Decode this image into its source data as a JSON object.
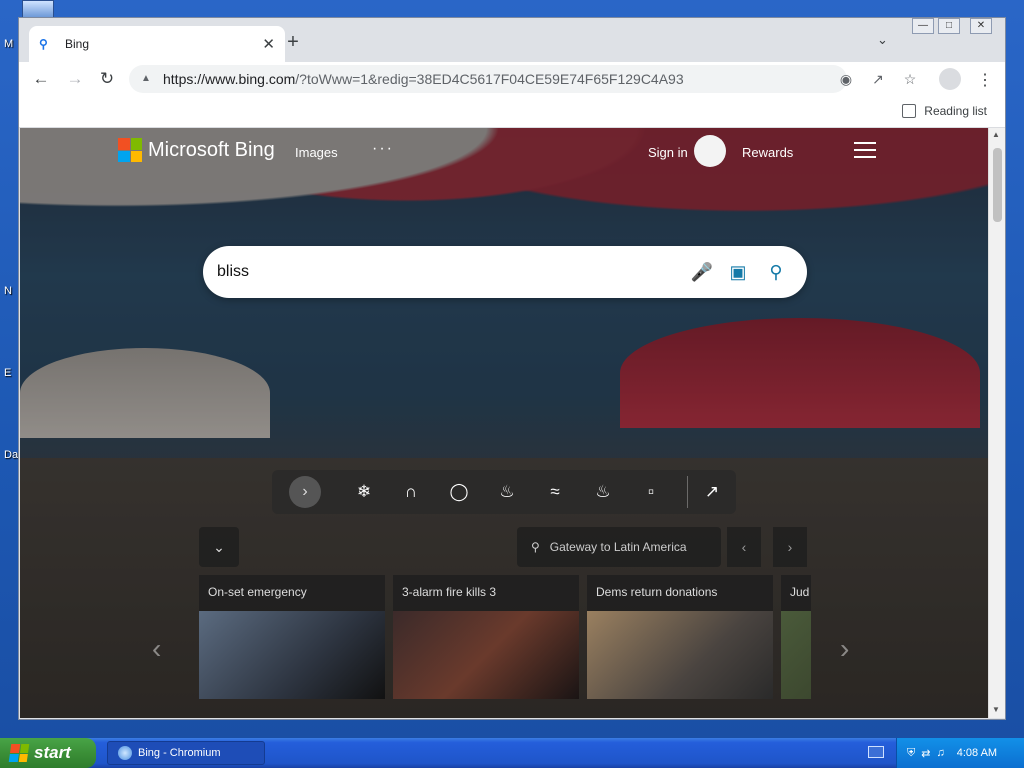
{
  "desktop": {
    "labels": [
      "M",
      "N",
      "E",
      "Da"
    ]
  },
  "window": {
    "title_controls": [
      "minimize",
      "maximize",
      "close"
    ]
  },
  "tab": {
    "title": "Bing",
    "favicon": "search-icon"
  },
  "toolbar": {
    "url_host": "https://www.bing.com",
    "url_rest": "/?toWww=1&redig=38ED4C5617F04CE59E74F65F129C4A93",
    "reading_list": "Reading list"
  },
  "bing": {
    "logo_text": "Microsoft Bing",
    "nav_images": "Images",
    "nav_more": "···",
    "sign_in": "Sign in",
    "rewards": "Rewards",
    "search_value": "bliss",
    "location": "Gateway to Latin America",
    "cards": [
      {
        "title": "On-set emergency"
      },
      {
        "title": "3-alarm fire kills 3"
      },
      {
        "title": "Dems return donations"
      },
      {
        "title": "Jud"
      }
    ],
    "colors": {
      "ms_red": "#f25022",
      "ms_green": "#7fba00",
      "ms_blue": "#00a4ef",
      "ms_yellow": "#ffb900",
      "search_icon": "#147aa8"
    }
  },
  "taskbar": {
    "start_label": "start",
    "task_label": "Bing - Chromium",
    "clock": "4:08 AM"
  }
}
